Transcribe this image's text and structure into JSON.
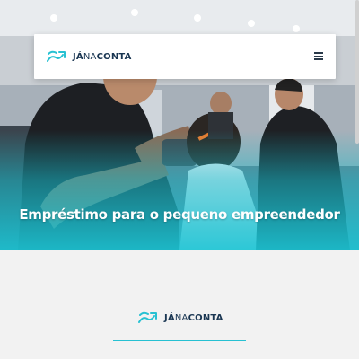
{
  "brand": {
    "name_part1": "JÁ",
    "name_part2": "NA",
    "name_part3": "CONTA",
    "logo_icon": "arrow-ribbon-icon",
    "accent_color": "#27c1d2",
    "text_color": "#1a3652"
  },
  "navbar": {
    "menu_icon": "hamburger-menu-icon"
  },
  "hero": {
    "title": "Empréstimo para o pequeno empreendedor",
    "overlay_color": "#1cc4d4"
  },
  "footer": {
    "logo_icon": "arrow-ribbon-icon"
  }
}
